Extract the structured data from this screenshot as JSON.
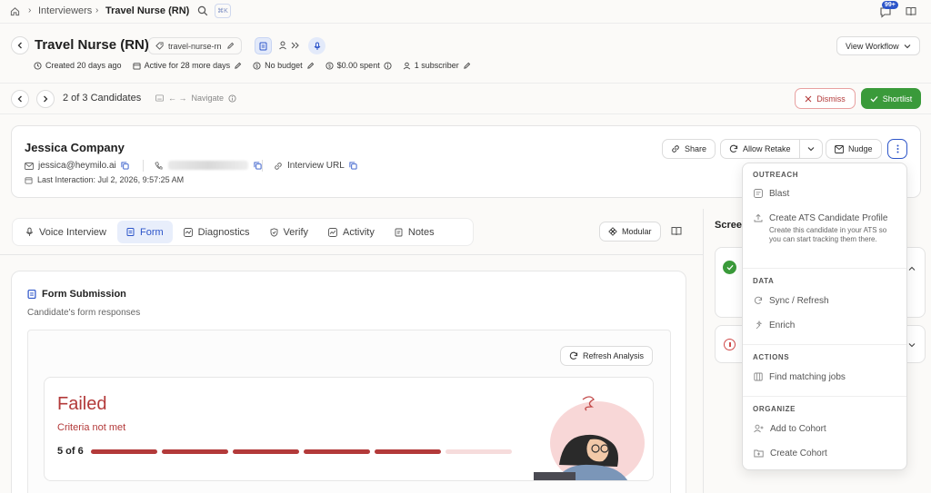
{
  "topbar": {
    "breadcrumb_root": "Interviewers",
    "breadcrumb_current": "Travel Nurse (RN)",
    "shortcut": "⌘K",
    "notif_badge": "99+"
  },
  "header": {
    "title": "Travel Nurse (RN)",
    "slug": "travel-nurse-rn",
    "view_workflow": "View Workflow",
    "meta": {
      "created": "Created 20 days ago",
      "active": "Active for 28 more days",
      "budget": "No budget",
      "spent": "$0.00 spent",
      "subscribers": "1 subscriber"
    }
  },
  "candidate_nav": {
    "counter": "2 of 3 Candidates",
    "navigate_hint": "Navigate",
    "dismiss": "Dismiss",
    "shortlist": "Shortlist"
  },
  "candidate": {
    "name": "Jessica Company",
    "email": "jessica@heymilo.ai",
    "interview_url": "Interview URL",
    "last_interaction": "Last Interaction: Jul 2, 2026, 9:57:25 AM",
    "share": "Share",
    "allow_retake": "Allow Retake",
    "nudge": "Nudge"
  },
  "tabs": [
    {
      "label": "Voice Interview"
    },
    {
      "label": "Form"
    },
    {
      "label": "Diagnostics"
    },
    {
      "label": "Verify"
    },
    {
      "label": "Activity"
    },
    {
      "label": "Notes"
    }
  ],
  "modular": "Modular",
  "form": {
    "title": "Form Submission",
    "subtitle": "Candidate's form responses",
    "refresh": "Refresh Analysis",
    "status": "Failed",
    "criteria": "Criteria not met",
    "score_text": "5 of 6",
    "score_passed": 5,
    "score_total": 6
  },
  "screening": {
    "title": "Screen"
  },
  "dropdown": {
    "sections": {
      "outreach": "OUTREACH",
      "data": "DATA",
      "actions": "ACTIONS",
      "organize": "ORGANIZE"
    },
    "items": {
      "blast": "Blast",
      "create_ats": "Create ATS Candidate Profile",
      "create_ats_desc": "Create this candidate in your ATS so you can start tracking them there.",
      "sync": "Sync / Refresh",
      "enrich": "Enrich",
      "find_jobs": "Find matching jobs",
      "add_cohort": "Add to Cohort",
      "create_cohort": "Create Cohort"
    }
  },
  "colors": {
    "accent": "#2d55c9",
    "success": "#3a9a3a",
    "danger": "#b33a3a",
    "danger_border": "#e8a0a0"
  }
}
